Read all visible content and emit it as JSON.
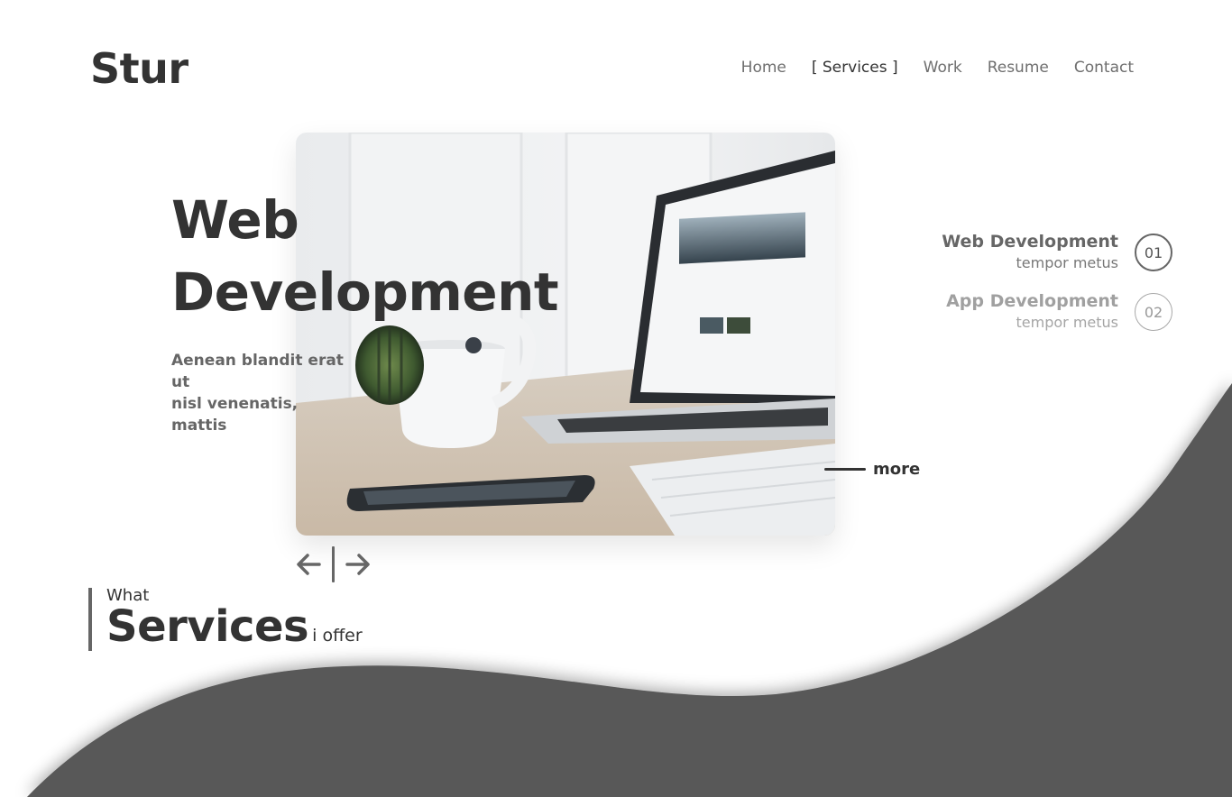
{
  "brand": {
    "logo": "Stur"
  },
  "nav": {
    "items": [
      {
        "label": "Home",
        "active": false
      },
      {
        "label": "[ Services ]",
        "active": true
      },
      {
        "label": "Work",
        "active": false
      },
      {
        "label": "Resume",
        "active": false
      },
      {
        "label": "Contact",
        "active": false
      }
    ]
  },
  "hero": {
    "title_line1": "Web",
    "title_line2": "Development",
    "description_line1": "Aenean blandit erat ut",
    "description_line2": "nisl venenatis, mattis",
    "more_label": "more"
  },
  "services": [
    {
      "title": "Web Development",
      "subtitle": "tempor metus",
      "number": "01",
      "active": true
    },
    {
      "title": "App Development",
      "subtitle": "tempor metus",
      "number": "02",
      "active": false
    }
  ],
  "section": {
    "kicker": "What",
    "title": "Services",
    "suffix": "i offer"
  },
  "icons": {
    "prev": "arrow-left-icon",
    "next": "arrow-right-icon"
  },
  "colors": {
    "text_dark": "#333333",
    "text_muted": "#666666",
    "wave_fill": "#585858",
    "background": "#ffffff"
  }
}
